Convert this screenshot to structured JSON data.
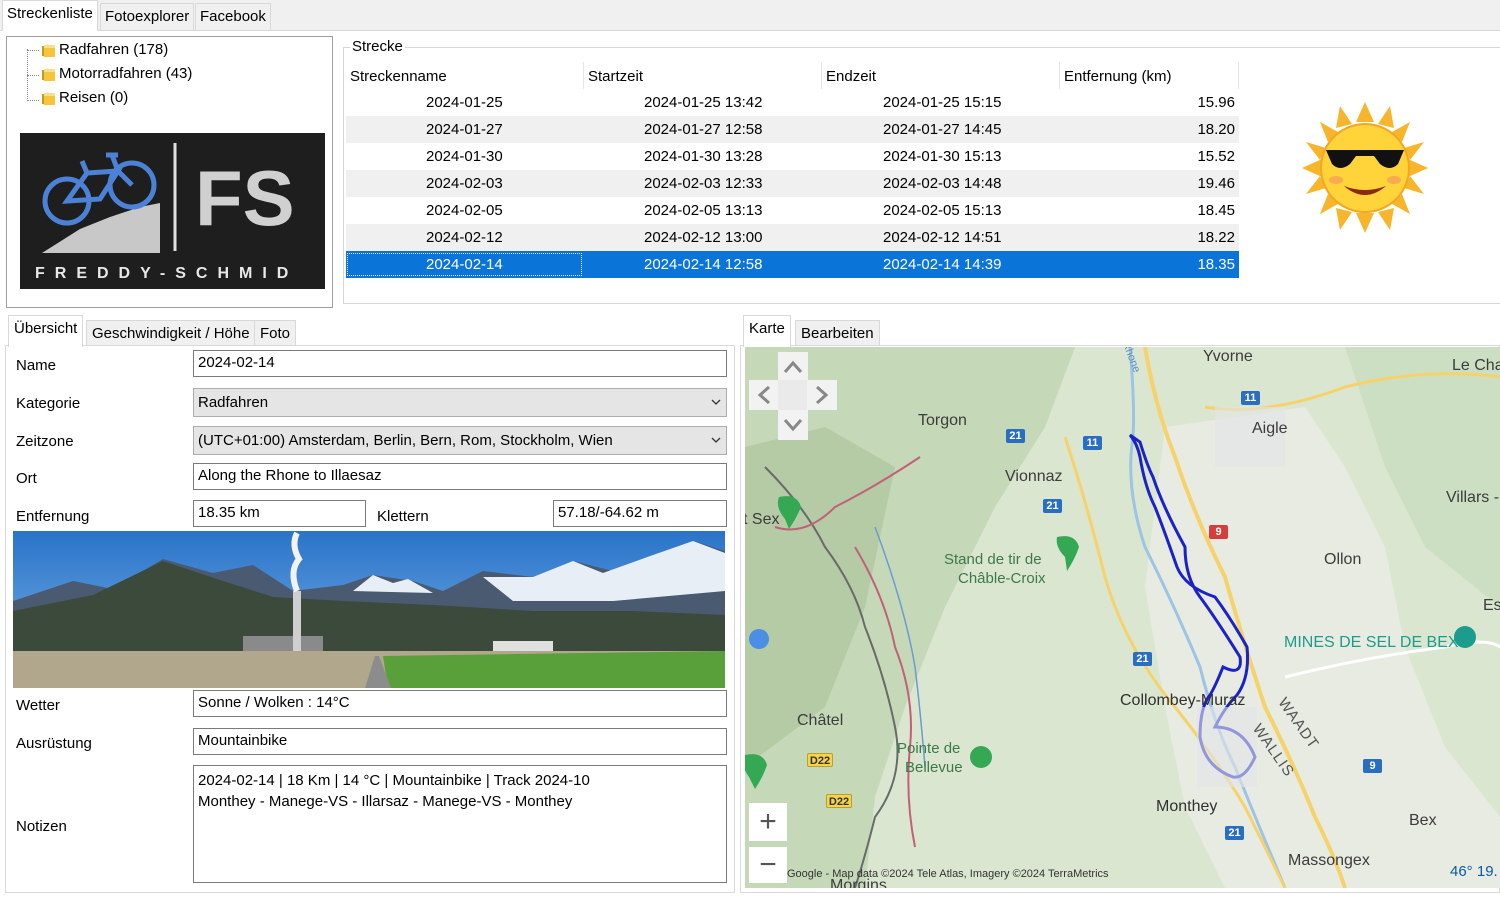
{
  "top_tabs": [
    "Streckenliste",
    "Fotoexplorer",
    "Facebook"
  ],
  "tree": [
    {
      "label": "Radfahren (178)"
    },
    {
      "label": "Motorradfahren (43)"
    },
    {
      "label": "Reisen (0)"
    }
  ],
  "logo": {
    "letters": "FS",
    "text": "FREDDY-SCHMID"
  },
  "strecke": {
    "legend": "Strecke",
    "columns": [
      "Streckenname",
      "Startzeit",
      "Endzeit",
      "Entfernung (km)"
    ],
    "rows": [
      {
        "name": "2024-01-25",
        "start": "2024-01-25 13:42",
        "end": "2024-01-25 15:15",
        "dist": "15.96"
      },
      {
        "name": "2024-01-27",
        "start": "2024-01-27 12:58",
        "end": "2024-01-27 14:45",
        "dist": "18.20"
      },
      {
        "name": "2024-01-30",
        "start": "2024-01-30 13:28",
        "end": "2024-01-30 15:13",
        "dist": "15.52"
      },
      {
        "name": "2024-02-03",
        "start": "2024-02-03 12:33",
        "end": "2024-02-03 14:48",
        "dist": "19.46"
      },
      {
        "name": "2024-02-05",
        "start": "2024-02-05 13:13",
        "end": "2024-02-05 15:13",
        "dist": "18.45"
      },
      {
        "name": "2024-02-12",
        "start": "2024-02-12 13:00",
        "end": "2024-02-12 14:51",
        "dist": "18.22"
      },
      {
        "name": "2024-02-14",
        "start": "2024-02-14 12:58",
        "end": "2024-02-14 14:39",
        "dist": "18.35"
      }
    ],
    "selected_index": 6
  },
  "detail_tabs": [
    "Übersicht",
    "Geschwindigkeit / Höhe",
    "Foto"
  ],
  "form": {
    "name_label": "Name",
    "name_value": "2024-02-14",
    "kategorie_label": "Kategorie",
    "kategorie_value": "Radfahren",
    "zeitzone_label": "Zeitzone",
    "zeitzone_value": "(UTC+01:00) Amsterdam, Berlin, Bern, Rom, Stockholm, Wien",
    "ort_label": "Ort",
    "ort_value": "Along the Rhone to Illaesaz",
    "entfernung_label": "Entfernung",
    "entfernung_value": "18.35 km",
    "klettern_label": "Klettern",
    "klettern_value": "57.18/-64.62 m",
    "wetter_label": "Wetter",
    "wetter_value": "Sonne / Wolken  :  14°C",
    "ausruestung_label": "Ausrüstung",
    "ausruestung_value": "Mountainbike",
    "notizen_label": "Notizen",
    "notizen_line1": "2024-02-14  |  18 Km  |  14 °C  |  Mountainbike  |  Track 2024-10",
    "notizen_line2": "Monthey - Manege-VS - Illarsaz - Manege-VS - Monthey"
  },
  "map_tabs": [
    "Karte",
    "Bearbeiten"
  ],
  "map": {
    "places": {
      "yvorne": "Yvorne",
      "le_cha": "Le Cha",
      "aigle": "Aigle",
      "torgon": "Torgon",
      "vionnaz": "Vionnaz",
      "villars": "Villars -",
      "t_sex": "t Sex",
      "stand_1": "Stand de tir de",
      "stand_2": "Châble-Croix",
      "ollon": "Ollon",
      "es": "Es",
      "mines": "MINES DE SEL DE BEX",
      "collombey": "Collombey-Muraz",
      "waadt": "WAADT",
      "wallis": "WALLIS",
      "chatel": "Châtel",
      "pointe_1": "Pointe de",
      "pointe_2": "Bellevue",
      "monthey": "Monthey",
      "bex": "Bex",
      "massongex": "Massongex",
      "morgins": "Morgins",
      "rhone": "Rhone"
    },
    "roads": {
      "r11a": "11",
      "r11b": "11",
      "r21a": "21",
      "r21b": "21",
      "r21c": "21",
      "r21d": "21",
      "r9a": "9",
      "r9b": "9",
      "d22a": "D22",
      "d22b": "D22"
    },
    "zoom_in": "+",
    "zoom_out": "−",
    "attribution": "Google - Map data ©2024 Tele Atlas, Imagery ©2024 TerraMetrics",
    "coordinate": "46° 19."
  },
  "colors": {
    "selection": "#0a74d9",
    "track": "#1a22c8",
    "map_bg": "#dde8d3"
  }
}
